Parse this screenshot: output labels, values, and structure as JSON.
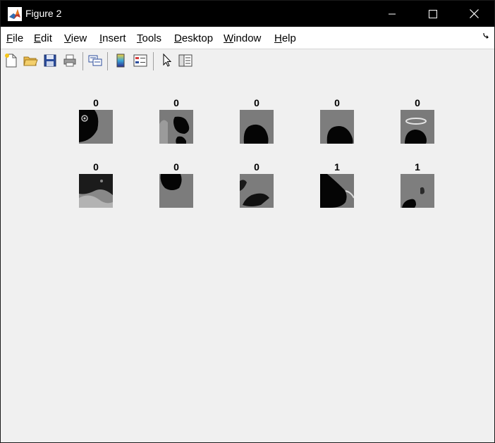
{
  "window": {
    "title": "Figure 2"
  },
  "menu": {
    "file": {
      "first": "F",
      "rest": "ile"
    },
    "edit": {
      "first": "E",
      "rest": "dit"
    },
    "view": {
      "first": "V",
      "rest": "iew"
    },
    "insert": {
      "first": "I",
      "rest": "nsert"
    },
    "tools": {
      "first": "T",
      "rest": "ools"
    },
    "desktop": {
      "first": "D",
      "rest": "esktop"
    },
    "window": {
      "first": "W",
      "rest": "indow"
    },
    "help": {
      "first": "H",
      "rest": "elp"
    }
  },
  "toolbar": {
    "icons": [
      "new-figure-icon",
      "open-file-icon",
      "save-figure-icon",
      "print-figure-icon",
      "link-plot-icon",
      "insert-colorbar-icon",
      "insert-legend-icon",
      "edit-plot-arrow-icon",
      "property-inspector-icon"
    ]
  },
  "subplots": [
    {
      "label": "0"
    },
    {
      "label": "0"
    },
    {
      "label": "0"
    },
    {
      "label": "0"
    },
    {
      "label": "0"
    },
    {
      "label": "0"
    },
    {
      "label": "0"
    },
    {
      "label": "0"
    },
    {
      "label": "1"
    },
    {
      "label": "1"
    }
  ],
  "colors": {
    "titlebar": "#000000",
    "menubar": "#ffffff",
    "canvas": "#f0f0f0"
  }
}
